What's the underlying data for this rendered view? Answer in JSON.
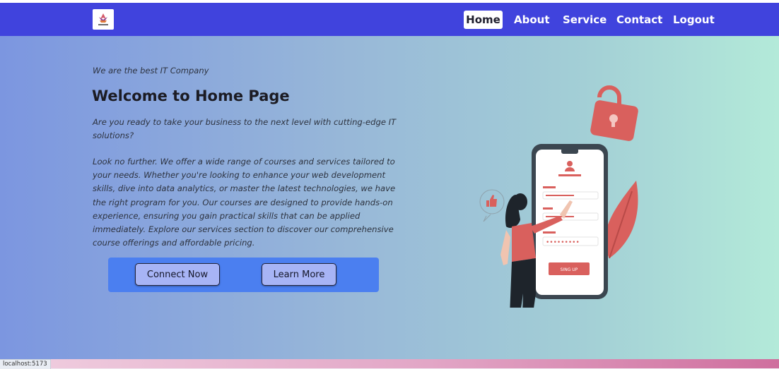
{
  "nav": {
    "logo_alt": "",
    "items": [
      {
        "label": "Home",
        "active": true
      },
      {
        "label": "About"
      },
      {
        "label": "Service"
      },
      {
        "label": "Contact"
      },
      {
        "label": "Logout"
      }
    ]
  },
  "hero": {
    "tagline": "We are the best IT Company",
    "title": "Welcome to Home Page",
    "paragraph1": "Are you ready to take your business to the next level with cutting-edge IT solutions?",
    "paragraph2": "Look no further. We offer a wide range of courses and services tailored to your needs. Whether you're looking to enhance your web development skills, dive into data analytics, or master the latest technologies, we have the right program for you. Our courses are designed to provide hands-on experience, ensuring you gain practical skills that can be applied immediately. Explore our services section to discover our comprehensive course offerings and affordable pricing.",
    "buttons": {
      "connect": "Connect Now",
      "learn": "Learn More"
    }
  },
  "illustration": {
    "password_mask": "•••••••••",
    "signup_label": "SING UP"
  },
  "status": {
    "url": "localhost:5173"
  },
  "colors": {
    "navbar": "#4043dd",
    "button_panel": "#4b7ff0",
    "button": "#a7b4f5",
    "accent_red": "#d9605d"
  }
}
